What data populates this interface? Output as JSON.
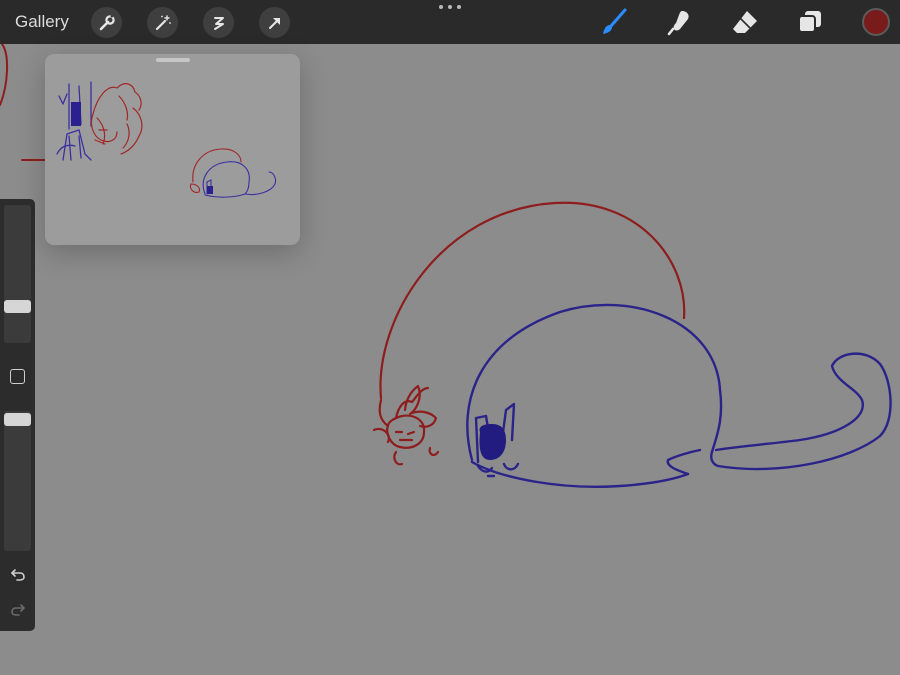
{
  "topbar": {
    "gallery_label": "Gallery",
    "tools_left": [
      "wrench-icon",
      "magic-wand-icon",
      "selection-icon",
      "transform-arrow-icon"
    ],
    "menu_dots": "more-options",
    "tools_right": [
      "brush-icon",
      "smudge-icon",
      "eraser-icon",
      "layers-icon"
    ],
    "active_tool": "brush",
    "current_color": "#7a1b1b"
  },
  "canvas": {
    "background": "#8c8c8c",
    "stroke_colors": {
      "red": "#8e1d1d",
      "blue": "#2a2389"
    }
  },
  "reference_window": {
    "background": "#9c9c9c"
  },
  "sidebar": {
    "brush_size_level": 0.47,
    "opacity_level": 0.05,
    "icons": [
      "modify-square-icon",
      "undo-icon",
      "redo-icon"
    ]
  }
}
